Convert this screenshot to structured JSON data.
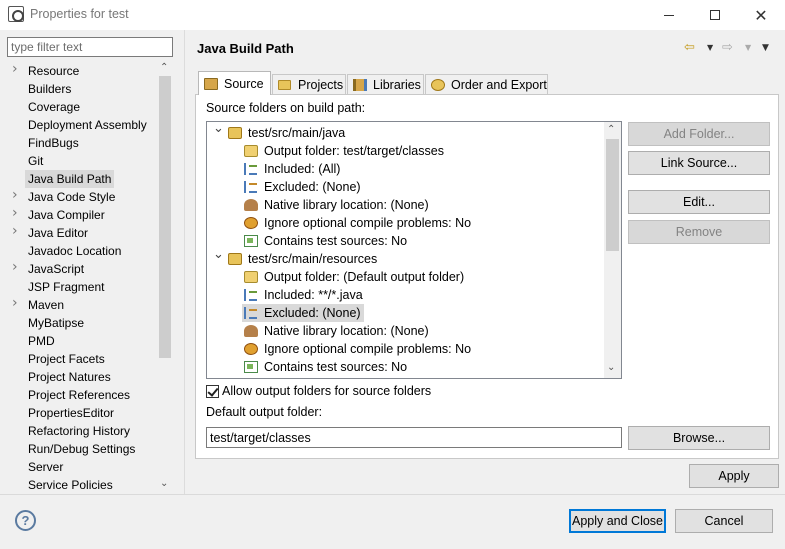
{
  "window": {
    "title": "Properties for test",
    "close_glyph": "✕"
  },
  "filter": {
    "placeholder": "type filter text"
  },
  "nav": {
    "items": [
      {
        "label": "Resource",
        "expandable": true,
        "selected": false
      },
      {
        "label": "Builders",
        "expandable": false,
        "selected": false
      },
      {
        "label": "Coverage",
        "expandable": false,
        "selected": false
      },
      {
        "label": "Deployment Assembly",
        "expandable": false,
        "selected": false
      },
      {
        "label": "FindBugs",
        "expandable": false,
        "selected": false
      },
      {
        "label": "Git",
        "expandable": false,
        "selected": false
      },
      {
        "label": "Java Build Path",
        "expandable": false,
        "selected": true
      },
      {
        "label": "Java Code Style",
        "expandable": true,
        "selected": false
      },
      {
        "label": "Java Compiler",
        "expandable": true,
        "selected": false
      },
      {
        "label": "Java Editor",
        "expandable": true,
        "selected": false
      },
      {
        "label": "Javadoc Location",
        "expandable": false,
        "selected": false
      },
      {
        "label": "JavaScript",
        "expandable": true,
        "selected": false
      },
      {
        "label": "JSP Fragment",
        "expandable": false,
        "selected": false
      },
      {
        "label": "Maven",
        "expandable": true,
        "selected": false
      },
      {
        "label": "MyBatipse",
        "expandable": false,
        "selected": false
      },
      {
        "label": "PMD",
        "expandable": false,
        "selected": false
      },
      {
        "label": "Project Facets",
        "expandable": false,
        "selected": false
      },
      {
        "label": "Project Natures",
        "expandable": false,
        "selected": false
      },
      {
        "label": "Project References",
        "expandable": false,
        "selected": false
      },
      {
        "label": "PropertiesEditor",
        "expandable": false,
        "selected": false
      },
      {
        "label": "Refactoring History",
        "expandable": false,
        "selected": false
      },
      {
        "label": "Run/Debug Settings",
        "expandable": false,
        "selected": false
      },
      {
        "label": "Server",
        "expandable": false,
        "selected": false
      },
      {
        "label": "Service Policies",
        "expandable": false,
        "selected": false
      }
    ]
  },
  "page": {
    "title": "Java Build Path",
    "tabs": [
      {
        "label": "Source",
        "active": true
      },
      {
        "label": "Projects",
        "active": false
      },
      {
        "label": "Libraries",
        "active": false
      },
      {
        "label": "Order and Export",
        "active": false
      }
    ],
    "source_label": "Source folders on build path:",
    "source_tree": [
      {
        "level": "root",
        "text": "test/src/main/java",
        "icon": "source-folder-icon"
      },
      {
        "level": "child",
        "text": "Output folder: test/target/classes",
        "icon": "output-folder-icon"
      },
      {
        "level": "child",
        "text": "Included: (All)",
        "icon": "included-filter-icon"
      },
      {
        "level": "child",
        "text": "Excluded: (None)",
        "icon": "excluded-filter-icon"
      },
      {
        "level": "child",
        "text": "Native library location: (None)",
        "icon": "native-library-icon"
      },
      {
        "level": "child",
        "text": "Ignore optional compile problems: No",
        "icon": "optional-problems-icon"
      },
      {
        "level": "child",
        "text": "Contains test sources: No",
        "icon": "test-sources-icon"
      },
      {
        "level": "root",
        "text": "test/src/main/resources",
        "icon": "source-folder-icon"
      },
      {
        "level": "child",
        "text": "Output folder: (Default output folder)",
        "icon": "output-folder-icon"
      },
      {
        "level": "child",
        "text": "Included: **/*.java",
        "icon": "included-filter-icon"
      },
      {
        "level": "child",
        "text": "Excluded: (None)",
        "icon": "excluded-filter-icon",
        "selected": true
      },
      {
        "level": "child",
        "text": "Native library location: (None)",
        "icon": "native-library-icon"
      },
      {
        "level": "child",
        "text": "Ignore optional compile problems: No",
        "icon": "optional-problems-icon"
      },
      {
        "level": "child",
        "text": "Contains test sources: No",
        "icon": "test-sources-icon"
      }
    ],
    "buttons": {
      "add_folder": "Add Folder...",
      "link_source": "Link Source...",
      "edit": "Edit...",
      "remove": "Remove",
      "browse": "Browse..."
    },
    "allow_output_label": "Allow output folders for source folders",
    "allow_output_checked": true,
    "default_output_label": "Default output folder:",
    "default_output_value": "test/target/classes"
  },
  "footer": {
    "apply": "Apply",
    "apply_and_close": "Apply and Close",
    "cancel": "Cancel",
    "help_glyph": "?"
  },
  "colors": {
    "selection": "#d9d9d9",
    "default_button_border": "#0078d7",
    "back_arrow": "#c49a1a"
  }
}
